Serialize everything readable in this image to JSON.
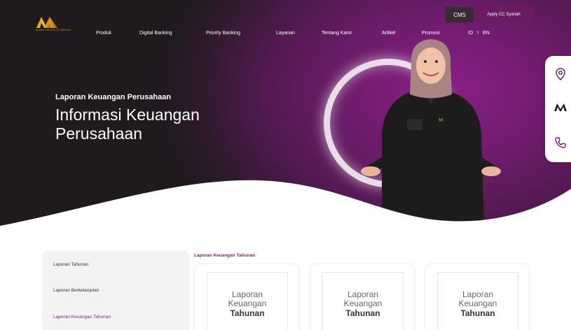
{
  "topbar": {
    "cms_label": "CMS",
    "apply_label": "Apply CC Syariah"
  },
  "brand": {
    "logo_sub": "BANK MEGA SYARIAH"
  },
  "nav": {
    "items": [
      "Produk",
      "Digital Banking",
      "Priority Banking",
      "Layanan",
      "Tentang Kami",
      "Artikel",
      "Promosi"
    ],
    "lang_id": "ID",
    "lang_sep": "I",
    "lang_en": "EN"
  },
  "hero": {
    "subtitle": "Laporan Keuangan Perusahaan",
    "title": "Informasi Keuangan Perusahaan"
  },
  "side_dock": {
    "icons": [
      "location-pin-icon",
      "brand-m-icon",
      "phone-icon"
    ]
  },
  "sidebar": {
    "items": [
      "Laporan Tahunan",
      "Laporan Berkelanjutan",
      "Laporan Keuangan Tahunan"
    ],
    "active_index": 2
  },
  "content": {
    "section_title": "Laporan Keuangan Tahunan",
    "cards": [
      {
        "line1": "Laporan",
        "line2": "Keuangan",
        "line3": "Tahunan"
      },
      {
        "line1": "Laporan",
        "line2": "Keuangan",
        "line3": "Tahunan"
      },
      {
        "line1": "Laporan",
        "line2": "Keuangan",
        "line3": "Tahunan"
      }
    ]
  },
  "colors": {
    "brand_purple": "#7a1f78",
    "hero_dark": "#1e1a1d",
    "gold": "#c99b34"
  }
}
